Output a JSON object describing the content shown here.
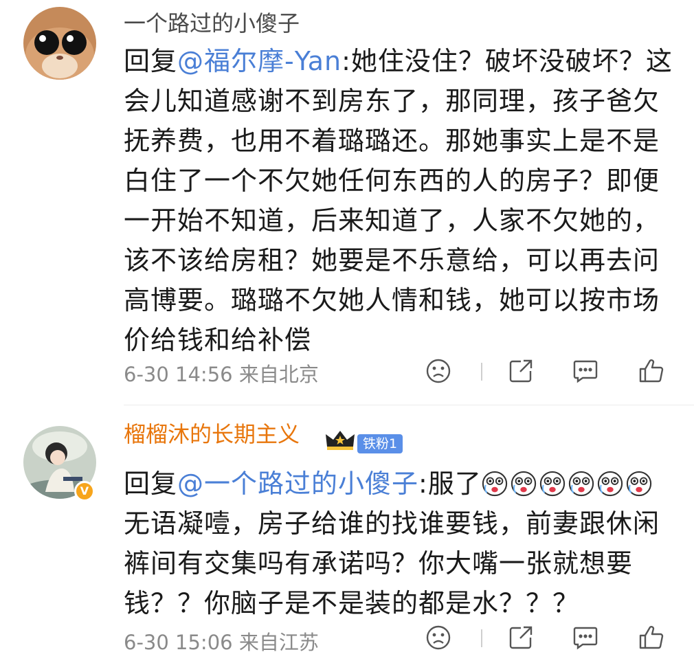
{
  "comments": [
    {
      "username": "一个路过的小傻子",
      "reply_prefix": "回复",
      "mention": "@福尔摩-Yan",
      "body": ":她住没住？破坏没破坏？这会儿知道感谢不到房东了，那同理，孩子爸欠抚养费，也用不着璐璐还。那她事实上是不是白住了一个不欠她任何东西的人的房子？即便一开始不知道，后来知道了，人家不欠她的，该不该给房租？她要是不乐意给，可以再去问高博要。璐璐不欠她人情和钱，她可以按市场价给钱和给补偿",
      "date": "6-30 14:56",
      "location": "来自北京"
    },
    {
      "username": "榴榴沐的长期主义",
      "fan_badge": "铁粉1",
      "reply_prefix": "回复",
      "mention": "@一个路过的小傻子",
      "body_before": ":服了",
      "emoji_count": 6,
      "body_after": "无语凝噎，房子给谁的找谁要钱，前妻跟休闲裤间有交集吗有承诺吗？你大嘴一张就想要钱？？你脑子是不是装的都是水？？？",
      "date": "6-30 15:06",
      "location": "来自江苏"
    }
  ],
  "colors": {
    "mention": "#4a7fd6",
    "username_vip": "#e8760c",
    "fan_badge": "#5a8fe8",
    "meta": "#8a8a8a"
  },
  "icons": [
    "dislike-icon",
    "share-icon",
    "comment-icon",
    "like-icon"
  ]
}
